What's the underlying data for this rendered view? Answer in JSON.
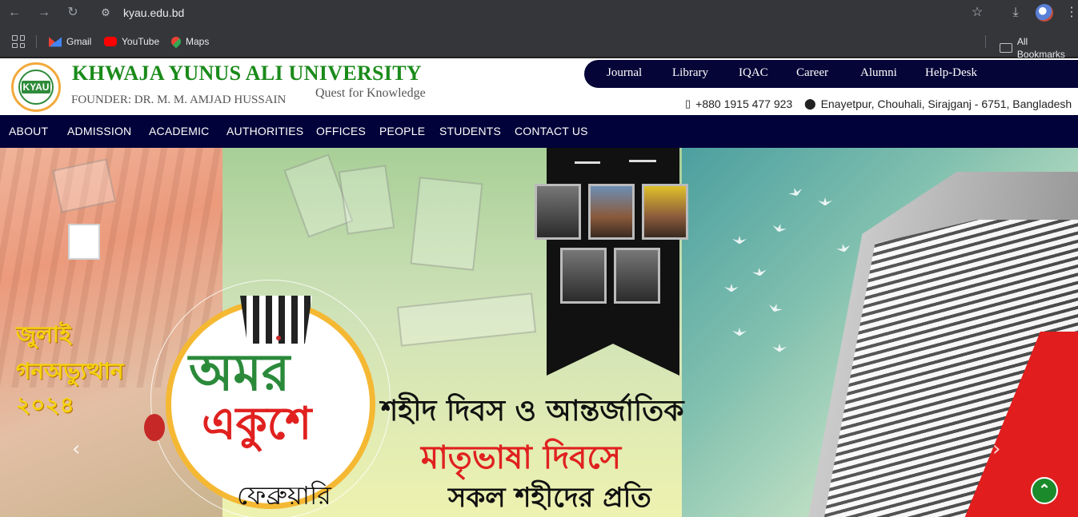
{
  "browser": {
    "url": "kyau.edu.bd",
    "bookmarks": [
      {
        "label": "Gmail",
        "icon": "gmail-icon"
      },
      {
        "label": "YouTube",
        "icon": "youtube-icon"
      },
      {
        "label": "Maps",
        "icon": "maps-icon"
      }
    ],
    "all_bookmarks_label": "All Bookmarks"
  },
  "header": {
    "university_name": "KHWAJA YUNUS ALI UNIVERSITY",
    "founder": "FOUNDER: DR. M. M. AMJAD HUSSAIN",
    "tagline": "Quest for Knowledge",
    "logo_text": "KYAU"
  },
  "top_nav": [
    "Journal",
    "Library",
    "IQAC",
    "Career",
    "Alumni",
    "Help-Desk"
  ],
  "contact": {
    "phone": "+880 1915 477 923",
    "address": "Enayetpur, Chouhali, Sirajganj - 6751, Bangladesh"
  },
  "main_nav": [
    "ABOUT",
    "ADMISSION",
    "ACADEMIC",
    "AUTHORITIES",
    "OFFICES",
    "PEOPLE",
    "STUDENTS",
    "CONTACT US"
  ],
  "hero": {
    "left_text": [
      "জুলাই",
      "গনঅভ্যুত্থান",
      "২০২৪"
    ],
    "badge_title_1": "অমর",
    "badge_title_2": "একুশে",
    "badge_subtitle": "ফেব্রুয়ারি",
    "line1": "শহীদ দিবস ও আন্তর্জাতিক",
    "line2": "মাতৃভাষা দিবসে",
    "line3": "সকল শহীদের প্রতি"
  }
}
